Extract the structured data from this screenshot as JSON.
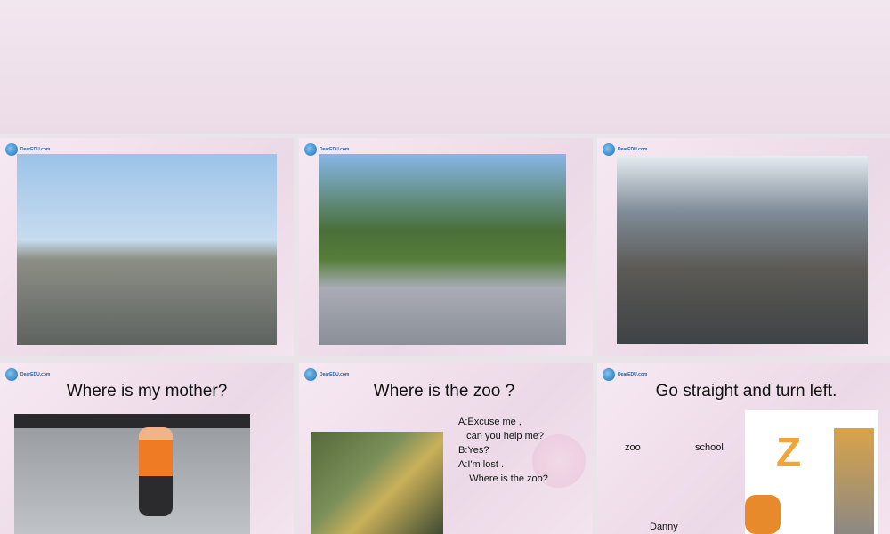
{
  "logo_text": "DearEDU.com",
  "slides": [
    {
      "id": 1
    },
    {
      "id": 2
    },
    {
      "id": 3
    },
    {
      "id": 4,
      "title": "Where is my mother?"
    },
    {
      "id": 5,
      "title": "Where is the zoo ?",
      "dialog": [
        "A:Excuse me ,",
        "   can you help me?",
        "B:Yes?",
        "A:I'm lost .",
        "    Where is the zoo?"
      ]
    },
    {
      "id": 6,
      "title": "Go straight and turn left.",
      "labels": {
        "zoo": "zoo",
        "school": "school",
        "danny": "Danny"
      }
    }
  ]
}
